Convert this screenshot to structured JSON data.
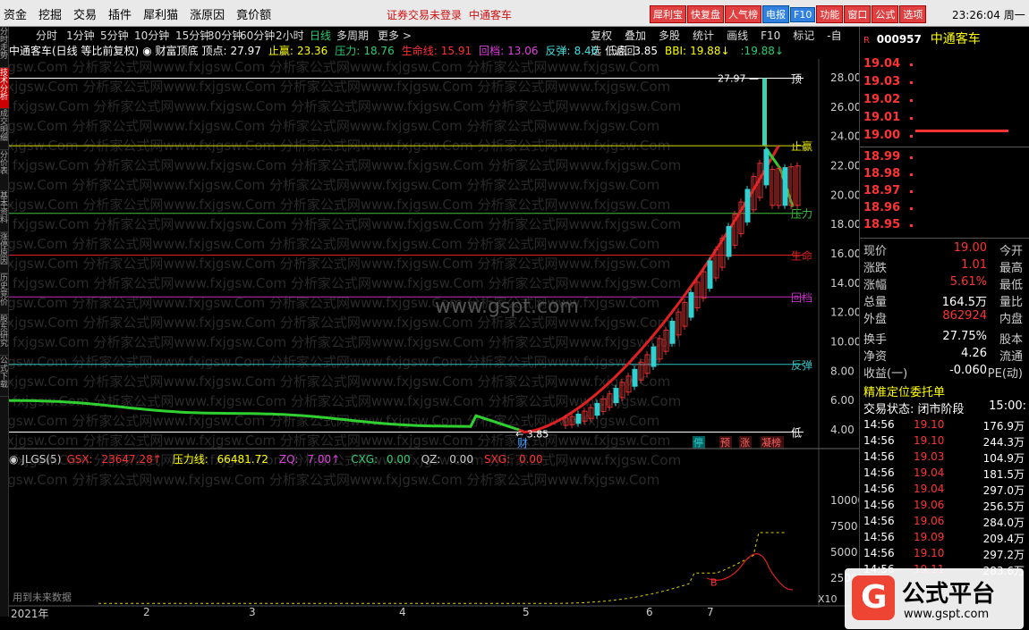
{
  "menu": [
    "资金",
    "挖掘",
    "交易",
    "插件",
    "犀利猫",
    "涨原因",
    "竟价额"
  ],
  "notice": [
    "证券交易未登录",
    "中通客车"
  ],
  "topbuttons": [
    "犀利宝",
    "快复盘",
    "人气榜",
    "电报",
    "F10",
    "功能",
    "窗口",
    "公式",
    "选项"
  ],
  "clock": "23:26:04 周一",
  "leftbar": [
    "分时走势",
    "技术分析",
    "成交明细",
    "分价表",
    "基本资料",
    "涨停原因",
    "历史竞价",
    "股东研究",
    "公式下载"
  ],
  "periods": [
    "分时",
    "1分钟",
    "5分钟",
    "10分钟",
    "15分钟",
    "30分钟",
    "60分钟",
    "2小时",
    "日线",
    "多周期",
    "更多 >"
  ],
  "active_period": "日线",
  "tools": [
    "复权",
    "叠加",
    "多股",
    "统计",
    "画线",
    "F10",
    "标记",
    "-自选",
    "返回"
  ],
  "info": {
    "title": "中通客车(日线 等比前复权)",
    "indicator": "财富顶底",
    "items": [
      {
        "label": "顶点:",
        "value": "27.97",
        "color": "#ffffff"
      },
      {
        "label": "止赢:",
        "value": "23.36",
        "color": "#ffff00"
      },
      {
        "label": "压力:",
        "value": "18.76",
        "color": "#2ecc71"
      },
      {
        "label": "生命线:",
        "value": "15.91",
        "color": "#ff3030"
      },
      {
        "label": "回档:",
        "value": "13.06",
        "color": "#e040e0"
      },
      {
        "label": "反弹:",
        "value": "8.46",
        "color": "#40e0e0"
      },
      {
        "label": "低点:",
        "value": "3.85",
        "color": "#ffffff"
      },
      {
        "label": "BBI:",
        "value": "19.88↓",
        "color": "#ffff00"
      },
      {
        "label": "",
        "value": ":19.88↓",
        "color": "#2ecc71"
      }
    ]
  },
  "levels": [
    {
      "name": "顶",
      "value": 27.97,
      "color": "#ffffff"
    },
    {
      "name": "止赢",
      "value": 23.36,
      "color": "#e0e000"
    },
    {
      "name": "压力",
      "value": 18.76,
      "color": "#40c040"
    },
    {
      "name": "生命",
      "value": 15.91,
      "color": "#e02020"
    },
    {
      "name": "回档",
      "value": 13.06,
      "color": "#c030c0"
    },
    {
      "name": "反弹",
      "value": 8.46,
      "color": "#30c0c0"
    },
    {
      "name": "低",
      "value": 3.85,
      "color": "#ffffff"
    }
  ],
  "price_axis": [
    "28.00",
    "26.00",
    "24.00",
    "22.00",
    "20.00",
    "18.00",
    "16.00",
    "14.00",
    "12.00",
    "10.00",
    "8.00",
    "6.00",
    "4.00"
  ],
  "annotations": {
    "high": "27.97",
    "low": "3.85",
    "cai": "财",
    "markers": [
      "停",
      "预",
      "涨",
      "凝榜"
    ]
  },
  "subchart": {
    "title": "JLGS(5)",
    "items": [
      {
        "label": "GSX:",
        "value": "23647.28↑",
        "color": "#ff3030"
      },
      {
        "label": "压力线:",
        "value": "66481.72",
        "color": "#ffff00"
      },
      {
        "label": "ZQ:",
        "value": "7.00↑",
        "color": "#e040e0"
      },
      {
        "label": "CXG:",
        "value": "0.00",
        "color": "#2ecc71"
      },
      {
        "label": "QZ:",
        "value": "0.00",
        "color": "#cccccc"
      },
      {
        "label": "SXG:",
        "value": "0.00",
        "color": "#ff3030"
      }
    ],
    "axis": [
      "10000",
      "7500",
      "5000",
      "2500"
    ],
    "footer_note": "用到未来数据",
    "unit": "X10",
    "mark_b": "B"
  },
  "months": [
    "2021年",
    "2",
    "3",
    "4",
    "5",
    "6",
    "7"
  ],
  "right": {
    "code": "000957",
    "name": "中通客车",
    "r_badge": "R",
    "asks": [
      "19.04",
      "19.03",
      "19.02",
      "19.01",
      "19.00"
    ],
    "bids": [
      "18.99",
      "18.98",
      "18.97",
      "18.96",
      "18.95"
    ],
    "quote": [
      {
        "l": "现价",
        "v": "19.00",
        "r": "今开",
        "c": "#ff3333"
      },
      {
        "l": "涨跌",
        "v": "1.01",
        "r": "最高",
        "c": "#ff3333"
      },
      {
        "l": "涨幅",
        "v": "5.61%",
        "r": "最低",
        "c": "#ff3333"
      },
      {
        "l": "总量",
        "v": "164.5万",
        "r": "量比",
        "c": "#ffffff"
      },
      {
        "l": "外盘",
        "v": "862924",
        "r": "内盘",
        "c": "#ff3333"
      },
      {
        "l": "换手",
        "v": "27.75%",
        "r": "股本",
        "c": "#ffffff"
      },
      {
        "l": "净资",
        "v": "4.26",
        "r": "流通",
        "c": "#ffffff"
      },
      {
        "l": "收益(一)",
        "v": "-0.060",
        "r": "PE(动)",
        "c": "#ffffff"
      }
    ],
    "precise": "精准定位委托单",
    "status": "交易状态: 闭市阶段",
    "status_time": "15:00:",
    "ticks": [
      {
        "t": "14:56",
        "p": "19.10",
        "v": "176.9万"
      },
      {
        "t": "14:56",
        "p": "19.10",
        "v": "244.3万"
      },
      {
        "t": "14:56",
        "p": "19.03",
        "v": "104.9万"
      },
      {
        "t": "14:56",
        "p": "19.04",
        "v": "181.5万"
      },
      {
        "t": "14:56",
        "p": "19.04",
        "v": "297.0万"
      },
      {
        "t": "14:56",
        "p": "19.06",
        "v": "256.5万"
      },
      {
        "t": "14:56",
        "p": "19.06",
        "v": "284.0万"
      },
      {
        "t": "14:56",
        "p": "19.09",
        "v": "209.4万"
      },
      {
        "t": "14:56",
        "p": "19.10",
        "v": "297.2万"
      },
      {
        "t": "14:56",
        "p": "19.11",
        "v": "283.6万"
      }
    ]
  },
  "watermark": "fxjgsw.Com 分析家公式网www.fxjgsw.Com 分析家公式网www.fxjgsw.Com 分析家公式网www.fxjgsw.Com",
  "watermark_center": "www.gspt.com",
  "logo": {
    "title": "公式平台",
    "url": "www.gspt.com",
    "glyph": "G"
  }
}
